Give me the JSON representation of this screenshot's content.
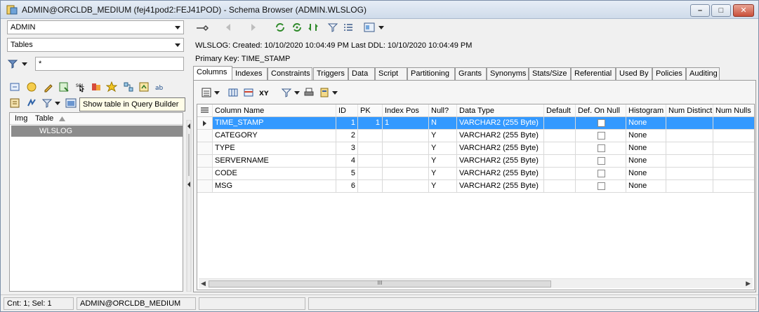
{
  "window": {
    "title": "ADMIN@ORCLDB_MEDIUM (fej41pod2:FEJ41POD) - Schema Browser (ADMIN.WLSLOG)"
  },
  "left": {
    "schema_combo": "ADMIN",
    "type_combo": "Tables",
    "filter_value": "*",
    "tooltip": "Show table in Query Builder",
    "list_headers": {
      "img": "Img",
      "table": "Table"
    },
    "list_items": [
      "WLSLOG"
    ]
  },
  "info": {
    "table_line": "WLSLOG:  Created: 10/10/2020 10:04:49 PM   Last DDL: 10/10/2020 10:04:49 PM",
    "pk_line": "Primary Key:  TIME_STAMP"
  },
  "tabs": [
    "Columns",
    "Indexes",
    "Constraints",
    "Triggers",
    "Data",
    "Script",
    "Partitioning",
    "Grants",
    "Synonyms",
    "Stats/Size",
    "Referential",
    "Used By",
    "Policies",
    "Auditing"
  ],
  "grid": {
    "headers": [
      "Column Name",
      "ID",
      "PK",
      "Index Pos",
      "Null?",
      "Data Type",
      "Default",
      "Def. On Null",
      "Histogram",
      "Num Distinct",
      "Num Nulls"
    ],
    "rows": [
      {
        "name": "TIME_STAMP",
        "id": "1",
        "pk": "1",
        "index_pos": "1",
        "null": "N",
        "type": "VARCHAR2 (255 Byte)",
        "default": "",
        "histogram": "None"
      },
      {
        "name": "CATEGORY",
        "id": "2",
        "pk": "",
        "index_pos": "",
        "null": "Y",
        "type": "VARCHAR2 (255 Byte)",
        "default": "",
        "histogram": "None"
      },
      {
        "name": "TYPE",
        "id": "3",
        "pk": "",
        "index_pos": "",
        "null": "Y",
        "type": "VARCHAR2 (255 Byte)",
        "default": "",
        "histogram": "None"
      },
      {
        "name": "SERVERNAME",
        "id": "4",
        "pk": "",
        "index_pos": "",
        "null": "Y",
        "type": "VARCHAR2 (255 Byte)",
        "default": "",
        "histogram": "None"
      },
      {
        "name": "CODE",
        "id": "5",
        "pk": "",
        "index_pos": "",
        "null": "Y",
        "type": "VARCHAR2 (255 Byte)",
        "default": "",
        "histogram": "None"
      },
      {
        "name": "MSG",
        "id": "6",
        "pk": "",
        "index_pos": "",
        "null": "Y",
        "type": "VARCHAR2 (255 Byte)",
        "default": "",
        "histogram": "None"
      }
    ],
    "scroll_mark": "III"
  },
  "status": {
    "count": "Cnt: 1; Sel: 1",
    "connection": "ADMIN@ORCLDB_MEDIUM"
  },
  "colors": {
    "selection": "#3399ff",
    "list_selection": "#8c8c8c"
  }
}
